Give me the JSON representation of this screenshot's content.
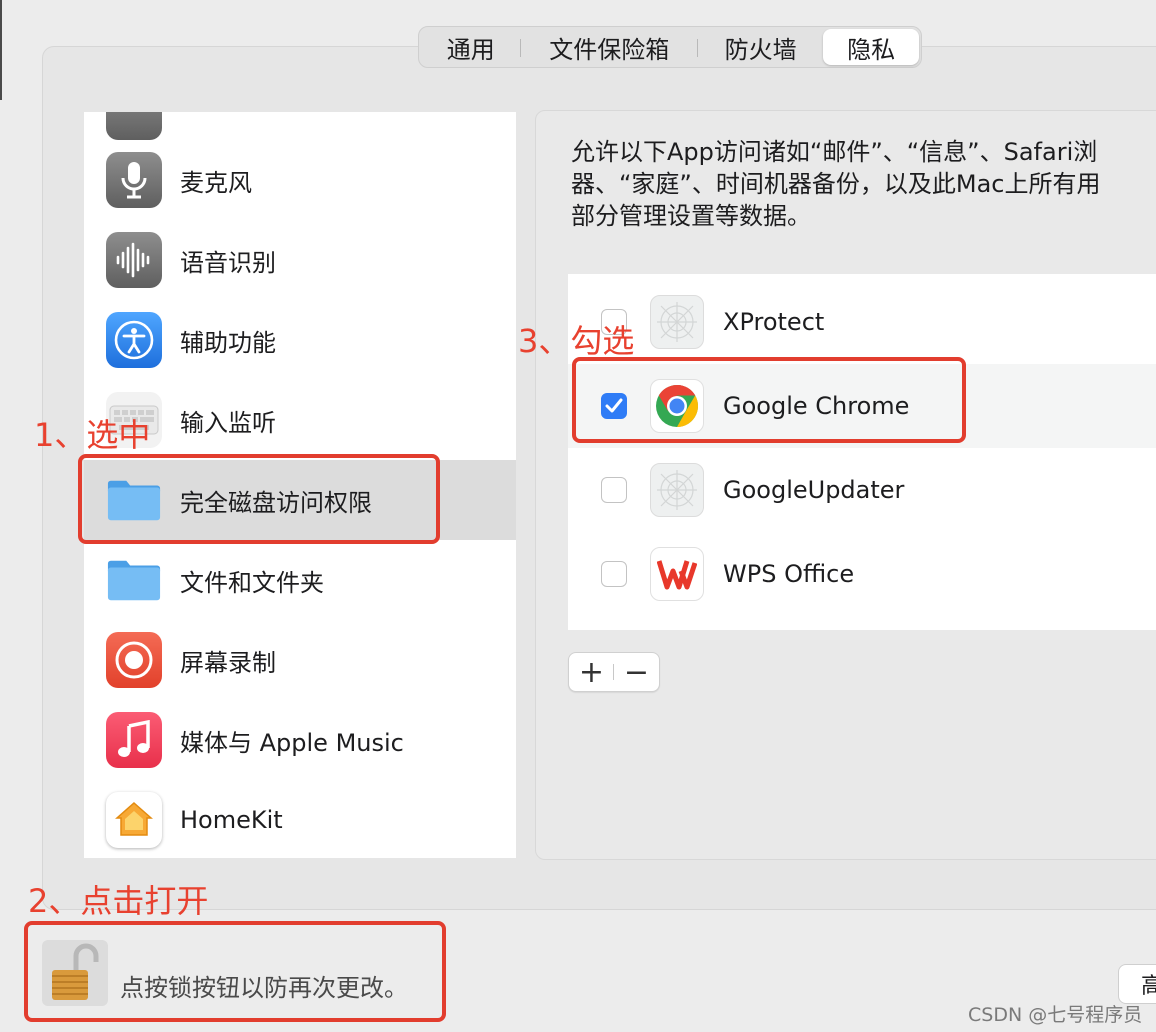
{
  "tabs": [
    "通用",
    "文件保险箱",
    "防火墙",
    "隐私"
  ],
  "active_tab": "隐私",
  "privacy_categories": [
    {
      "label": "麦克风",
      "icon": "microphone-icon"
    },
    {
      "label": "语音识别",
      "icon": "speech-waveform-icon"
    },
    {
      "label": "辅助功能",
      "icon": "accessibility-icon"
    },
    {
      "label": "输入监听",
      "icon": "keyboard-icon"
    },
    {
      "label": "完全磁盘访问权限",
      "icon": "folder-icon",
      "selected": true
    },
    {
      "label": "文件和文件夹",
      "icon": "folder-icon"
    },
    {
      "label": "屏幕录制",
      "icon": "screen-record-icon"
    },
    {
      "label": "媒体与 Apple Music",
      "icon": "music-note-icon"
    },
    {
      "label": "HomeKit",
      "icon": "home-icon"
    }
  ],
  "description_lines": [
    "允许以下App访问诸如“邮件”、“信息”、Safari浏",
    "器、“家庭”、时间机器备份，以及此Mac上所有用",
    "部分管理设置等数据。"
  ],
  "apps": [
    {
      "name": "XProtect",
      "checked": false
    },
    {
      "name": "Google Chrome",
      "checked": true
    },
    {
      "name": "GoogleUpdater",
      "checked": false
    },
    {
      "name": "WPS Office",
      "checked": false
    }
  ],
  "buttons": {
    "add": "+",
    "remove": "−",
    "advanced": "高"
  },
  "lock_text": "点按锁按钮以防再次更改。",
  "annotations": {
    "step1": "1、选中",
    "step2": "2、点击打开",
    "step3": "3、勾选",
    "color": "#e8412f"
  },
  "watermark": "CSDN @七号程序员"
}
